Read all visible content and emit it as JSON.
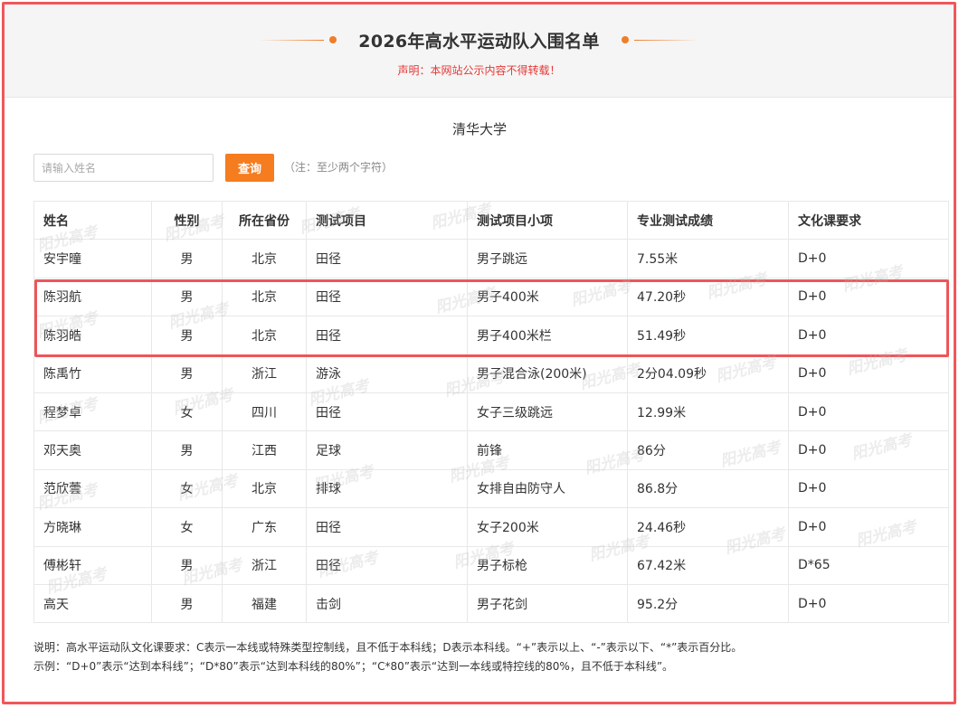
{
  "header": {
    "title": "2026年高水平运动队入围名单",
    "notice": "声明：本网站公示内容不得转载！"
  },
  "university": "清华大学",
  "search": {
    "placeholder": "请输入姓名",
    "button_label": "查询",
    "tip": "（注：至少两个字符）"
  },
  "table": {
    "columns": [
      "姓名",
      "性别",
      "所在省份",
      "测试项目",
      "测试项目小项",
      "专业测试成绩",
      "文化课要求"
    ],
    "rows": [
      [
        "安宇曈",
        "男",
        "北京",
        "田径",
        "男子跳远",
        "7.55米",
        "D+0"
      ],
      [
        "陈羽航",
        "男",
        "北京",
        "田径",
        "男子400米",
        "47.20秒",
        "D+0"
      ],
      [
        "陈羽皓",
        "男",
        "北京",
        "田径",
        "男子400米栏",
        "51.49秒",
        "D+0"
      ],
      [
        "陈禹竹",
        "男",
        "浙江",
        "游泳",
        "男子混合泳(200米)",
        "2分04.09秒",
        "D+0"
      ],
      [
        "程梦卓",
        "女",
        "四川",
        "田径",
        "女子三级跳远",
        "12.99米",
        "D+0"
      ],
      [
        "邓天奥",
        "男",
        "江西",
        "足球",
        "前锋",
        "86分",
        "D+0"
      ],
      [
        "范欣蕓",
        "女",
        "北京",
        "排球",
        "女排自由防守人",
        "86.8分",
        "D+0"
      ],
      [
        "方晓琳",
        "女",
        "广东",
        "田径",
        "女子200米",
        "24.46秒",
        "D+0"
      ],
      [
        "傅彬轩",
        "男",
        "浙江",
        "田径",
        "男子标枪",
        "67.42米",
        "D*65"
      ],
      [
        "高天",
        "男",
        "福建",
        "击剑",
        "男子花剑",
        "95.2分",
        "D+0"
      ]
    ]
  },
  "watermark": "阳光高考",
  "footnote": {
    "line1": "说明：高水平运动队文化课要求：C表示一本线或特殊类型控制线，且不低于本科线；D表示本科线。“+”表示以上、“-”表示以下、“*”表示百分比。",
    "line2": "示例：“D+0”表示“达到本科线”；“D*80”表示“达到本科线的80%”；“C*80”表示“达到一本线或特控线的80%，且不低于本科线”。"
  },
  "colors": {
    "accent": "#f57c1f",
    "notice": "#e53935",
    "highlight_border": "#ee5559"
  }
}
